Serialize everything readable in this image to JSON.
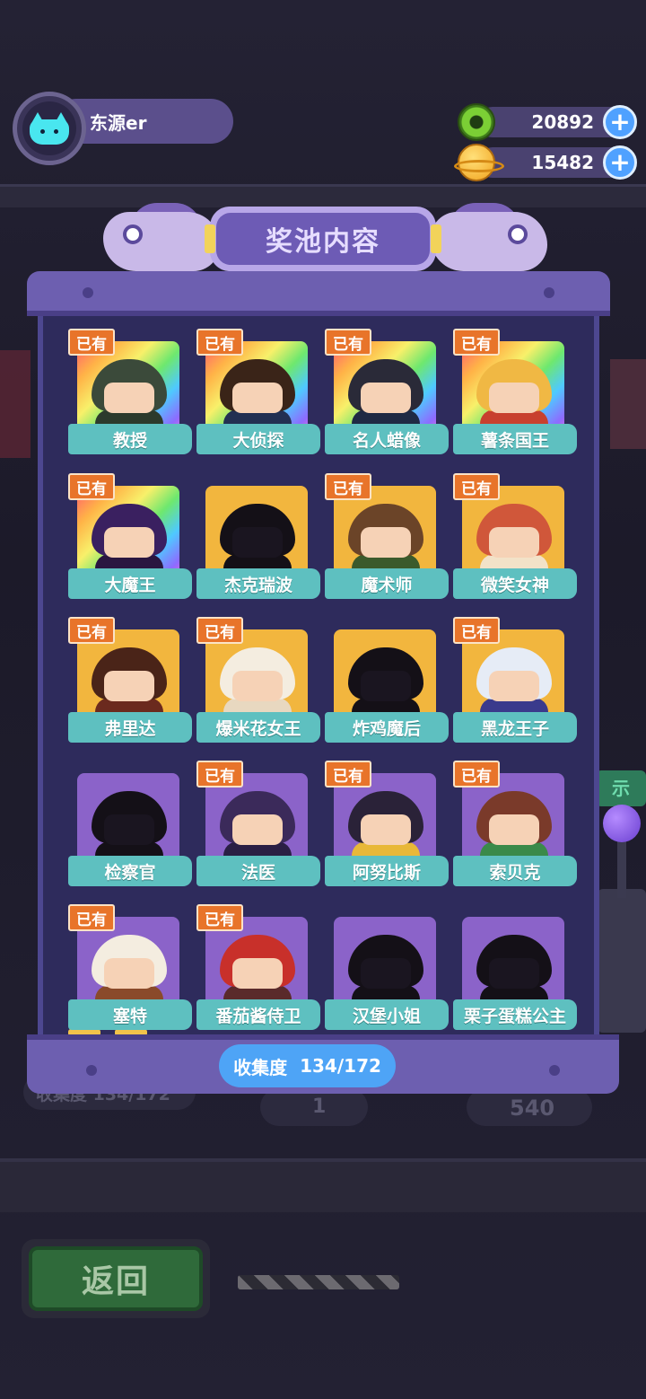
{
  "profile": {
    "name": "东源er"
  },
  "currencies": [
    {
      "icon": "donut-icon",
      "value": "20892"
    },
    {
      "icon": "planet-icon",
      "value": "15482"
    }
  ],
  "modal": {
    "title": "奖池内容",
    "collection_label": "收集度",
    "collection_value": "134/172"
  },
  "owned_label": "已有",
  "cards": [
    {
      "name": "教授",
      "owned": true,
      "frame": "rainbow",
      "hair": "#3b4a3a",
      "body": "#2c3a2c"
    },
    {
      "name": "大侦探",
      "owned": true,
      "frame": "rainbow",
      "hair": "#3a2418",
      "body": "#223052"
    },
    {
      "name": "名人蜡像",
      "owned": true,
      "frame": "rainbow",
      "hair": "#2a2a38",
      "body": "#1f2a44"
    },
    {
      "name": "薯条国王",
      "owned": true,
      "frame": "rainbow",
      "hair": "#f0b844",
      "body": "#c8402e"
    },
    {
      "name": "大魔王",
      "owned": true,
      "frame": "rainbow",
      "hair": "#3a2060",
      "body": "#2a1640"
    },
    {
      "name": "杰克瑞波",
      "owned": false,
      "frame": "gold",
      "hair": "#141017",
      "body": "#141017"
    },
    {
      "name": "魔术师",
      "owned": true,
      "frame": "gold",
      "hair": "#6b4428",
      "body": "#3b5a2c"
    },
    {
      "name": "微笑女神",
      "owned": true,
      "frame": "gold",
      "hair": "#d0573a",
      "body": "#f2e2c8"
    },
    {
      "name": "弗里达",
      "owned": true,
      "frame": "gold",
      "hair": "#4a2418",
      "body": "#6b2a1e"
    },
    {
      "name": "爆米花女王",
      "owned": true,
      "frame": "gold",
      "hair": "#f4ede0",
      "body": "#e8d8c0"
    },
    {
      "name": "炸鸡魔后",
      "owned": false,
      "frame": "gold",
      "hair": "#141017",
      "body": "#141017"
    },
    {
      "name": "黑龙王子",
      "owned": true,
      "frame": "gold",
      "hair": "#e6ecf6",
      "body": "#3a3a8c"
    },
    {
      "name": "检察官",
      "owned": false,
      "frame": "purple",
      "hair": "#141017",
      "body": "#141017"
    },
    {
      "name": "法医",
      "owned": true,
      "frame": "purple",
      "hair": "#3b2a5a",
      "body": "#2a1f44"
    },
    {
      "name": "阿努比斯",
      "owned": true,
      "frame": "purple",
      "hair": "#2a2238",
      "body": "#e8b838"
    },
    {
      "name": "索贝克",
      "owned": true,
      "frame": "purple",
      "hair": "#7a3a2a",
      "body": "#3a8a4a"
    },
    {
      "name": "塞特",
      "owned": true,
      "frame": "purple",
      "hair": "#f4ede0",
      "body": "#8a4a2a"
    },
    {
      "name": "番茄酱侍卫",
      "owned": true,
      "frame": "purple",
      "hair": "#c8302a",
      "body": "#5a2a2a"
    },
    {
      "name": "汉堡小姐",
      "owned": false,
      "frame": "purple",
      "hair": "#141017",
      "body": "#141017"
    },
    {
      "name": "栗子蛋糕公主",
      "owned": false,
      "frame": "purple",
      "hair": "#141017",
      "body": "#141017"
    }
  ],
  "background": {
    "ghost_collection": "收集度 134/172",
    "ghost_count": "1",
    "ghost_price": "540",
    "back_button": "返回",
    "side_label": "示"
  }
}
